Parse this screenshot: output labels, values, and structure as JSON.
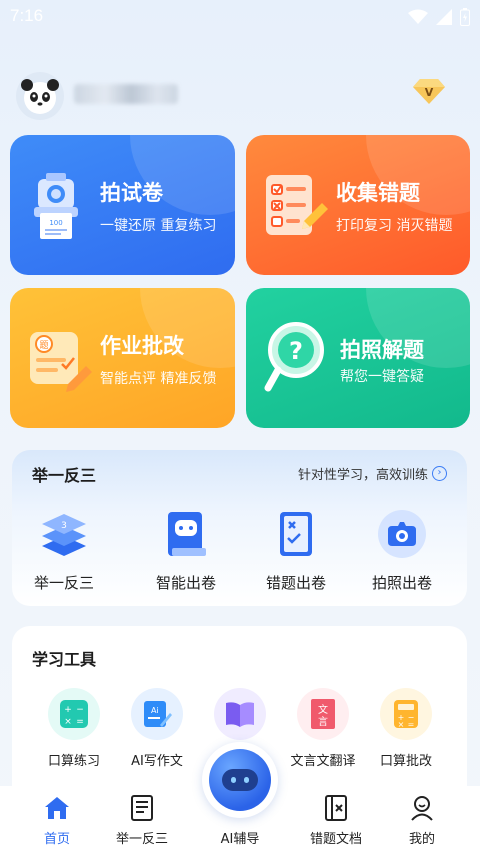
{
  "status_bar": {
    "time": "7:16"
  },
  "header": {
    "vip_badge_text": "V"
  },
  "cards": [
    {
      "title": "拍试卷",
      "subtitle": "一键还原  重复练习"
    },
    {
      "title": "收集错题",
      "subtitle": "打印复习  消灭错题"
    },
    {
      "title": "作业批改",
      "subtitle": "智能点评  精准反馈"
    },
    {
      "title": "拍照解题",
      "subtitle": "帮您一键答疑"
    }
  ],
  "practice_panel": {
    "title": "举一反三",
    "link_text": "针对性学习，高效训练",
    "items": [
      {
        "label": "举一反三",
        "icon": "stack-icon"
      },
      {
        "label": "智能出卷",
        "icon": "robot-book-icon"
      },
      {
        "label": "错题出卷",
        "icon": "checklist-icon"
      },
      {
        "label": "拍照出卷",
        "icon": "camera-icon"
      }
    ]
  },
  "tools": {
    "title": "学习工具",
    "items": [
      {
        "label": "口算练习",
        "icon": "calc-grid-icon"
      },
      {
        "label": "AI写作文",
        "icon": "ai-write-icon"
      },
      {
        "label": "",
        "icon": "book-icon"
      },
      {
        "label": "文言文翻译",
        "icon": "classical-text-icon"
      },
      {
        "label": "口算批改",
        "icon": "calculator-icon"
      }
    ]
  },
  "bottom_nav": {
    "items": [
      {
        "label": "首页",
        "icon": "home-icon",
        "active": true
      },
      {
        "label": "举一反三",
        "icon": "document-icon",
        "active": false
      },
      {
        "label": "AI辅导",
        "icon": "ai-robot-icon",
        "active": false
      },
      {
        "label": "错题文档",
        "icon": "wrong-doc-icon",
        "active": false
      },
      {
        "label": "我的",
        "icon": "profile-icon",
        "active": false
      }
    ]
  },
  "colors": {
    "accent": "#2f6cf0",
    "blue_card": "#3f8cf8",
    "orange_card": "#ff6a30",
    "yellow_card": "#ffb52e",
    "green_card": "#1cc596"
  }
}
